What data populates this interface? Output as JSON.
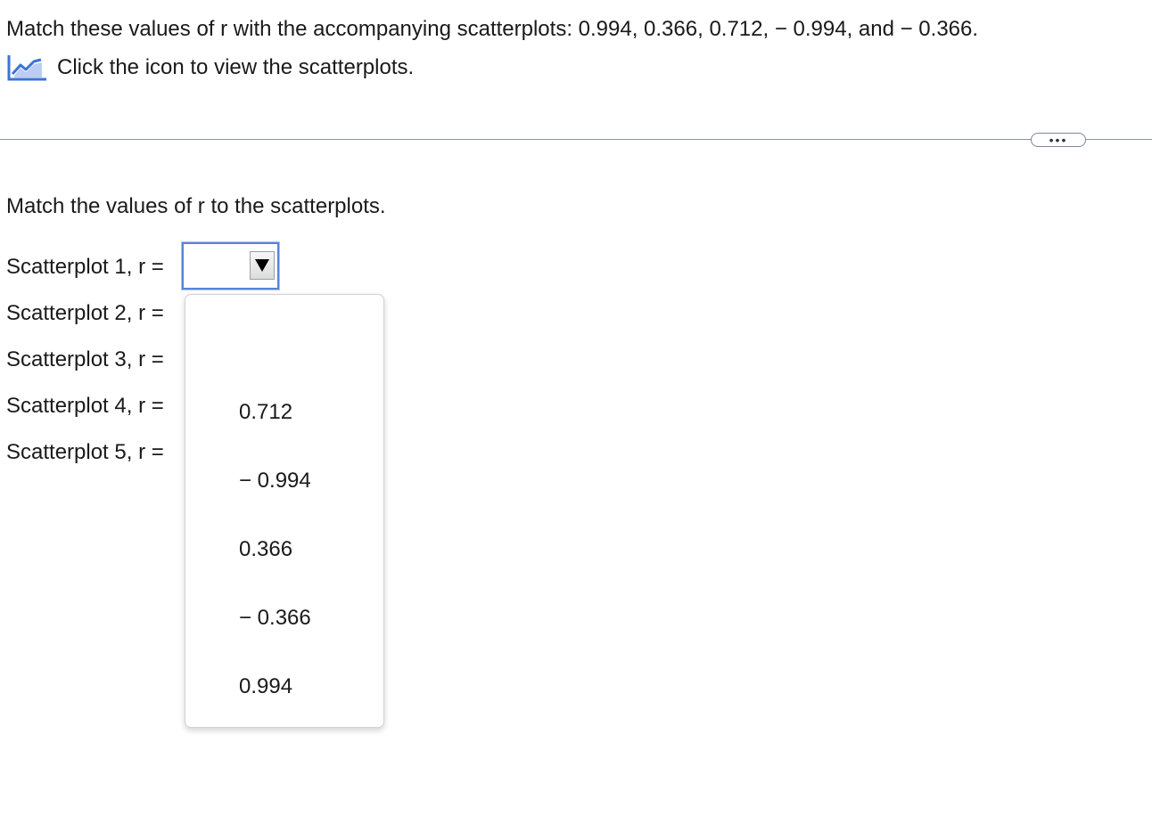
{
  "question": {
    "text": "Match these values of r with the accompanying scatterplots: 0.994, 0.366, 0.712,  − 0.994, and  − 0.366.",
    "icon_link_label": "Click the icon to view the scatterplots.",
    "icon": "line-chart-icon"
  },
  "more_button": {
    "label": "•••"
  },
  "answer": {
    "instruction": "Match the values of r to the scatterplots.",
    "rows": [
      {
        "label": "Scatterplot 1, r =",
        "selected": ""
      },
      {
        "label": "Scatterplot 2, r =",
        "selected": ""
      },
      {
        "label": "Scatterplot 3, r =",
        "selected": ""
      },
      {
        "label": "Scatterplot 4, r =",
        "selected": ""
      },
      {
        "label": "Scatterplot 5, r =",
        "selected": ""
      }
    ]
  },
  "dropdown": {
    "open": true,
    "options": [
      "0.712",
      " − 0.994",
      "0.366",
      " − 0.366",
      "0.994"
    ]
  },
  "colors": {
    "icon_blue": "#3b73d6",
    "focus_border": "#5a83d9",
    "divider": "#8b95a6"
  }
}
